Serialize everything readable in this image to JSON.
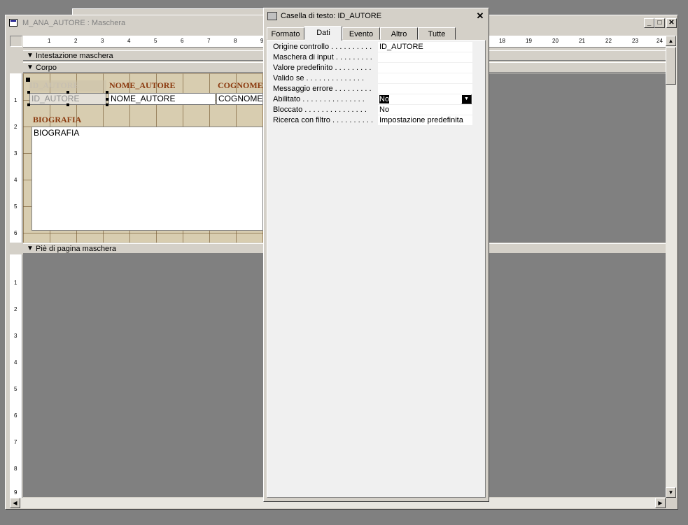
{
  "form_window": {
    "title": "M_ANA_AUTORE : Maschera"
  },
  "ruler": {
    "h_numbers": [
      "1",
      "2",
      "3",
      "4",
      "5",
      "6",
      "7",
      "8",
      "9",
      "18",
      "19",
      "20",
      "21",
      "22",
      "23",
      "24"
    ],
    "v_detail": [
      "1",
      "2",
      "3",
      "4",
      "5",
      "6"
    ],
    "v_footer": [
      "1",
      "2",
      "3",
      "4",
      "5",
      "6",
      "7",
      "8",
      "9"
    ]
  },
  "sections": {
    "header": "Intestazione maschera",
    "detail": "Corpo",
    "footer": "Piè di pagina maschera"
  },
  "controls": {
    "label_id": "ID_AUTORE",
    "text_id": "ID_AUTORE",
    "label_nome": "NOME_AUTORE",
    "text_nome": "NOME_AUTORE",
    "label_cognome": "COGNOME_",
    "text_cognome": "COGNOME_",
    "label_bio": "BIOGRAFIA",
    "text_bio": "BIOGRAFIA"
  },
  "property_sheet": {
    "title": "Casella di testo: ID_AUTORE",
    "close_symbol": "✕",
    "tabs": [
      "Formato",
      "Dati",
      "Evento",
      "Altro",
      "Tutte"
    ],
    "active_tab": "Dati",
    "properties": [
      {
        "name": "Origine controllo . . . . . . . . . .",
        "value": "ID_AUTORE"
      },
      {
        "name": "Maschera di input . . . . . . . . .",
        "value": ""
      },
      {
        "name": "Valore predefinito . . . . . . . . .",
        "value": ""
      },
      {
        "name": "Valido se . . . . . . . . . . . . . .",
        "value": ""
      },
      {
        "name": "Messaggio errore . . . . . . . . .",
        "value": ""
      },
      {
        "name": "Abilitato . . . . . . . . . . . . . . .",
        "value": "No"
      },
      {
        "name": "Bloccato . . . . . . . . . . . . . . .",
        "value": "No"
      },
      {
        "name": "Ricerca con filtro . . . . . . . . . .",
        "value": "Impostazione predefinita"
      }
    ]
  },
  "icons": {
    "minimize": "minimize-icon",
    "restore": "restore-icon",
    "close": "close-icon",
    "scroll_up": "scroll-up-icon",
    "scroll_down": "scroll-down-icon",
    "scroll_left": "scroll-left-icon",
    "scroll_right": "scroll-right-icon"
  }
}
